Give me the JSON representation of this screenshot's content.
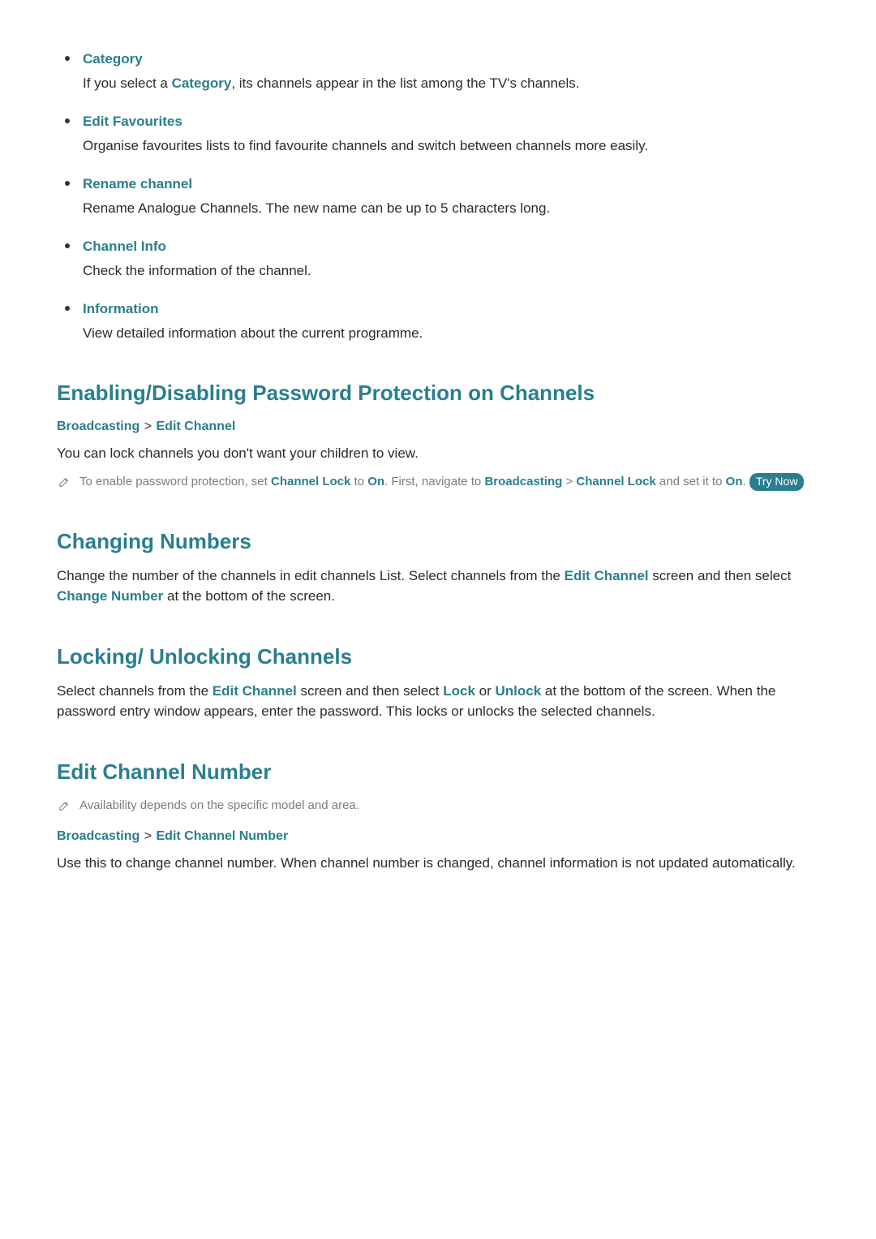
{
  "list": [
    {
      "title": "Category",
      "body_pre": "If you select a ",
      "body_link": "Category",
      "body_post": ", its channels appear in the list among the TV's channels."
    },
    {
      "title": "Edit Favourites",
      "body": "Organise favourites lists to find favourite channels and switch between channels more easily."
    },
    {
      "title": "Rename channel",
      "body": "Rename Analogue Channels. The new name can be up to 5 characters long."
    },
    {
      "title": "Channel Info",
      "body": "Check the information of the channel."
    },
    {
      "title": "Information",
      "body": "View detailed information about the current programme."
    }
  ],
  "sections": {
    "enabling": {
      "heading": "Enabling/Disabling Password Protection on Channels",
      "crumb1": "Broadcasting",
      "sep": ">",
      "crumb2": "Edit Channel",
      "body": "You can lock channels you don't want your children to view.",
      "note_t1": "To enable password protection, set ",
      "note_channel_lock": "Channel Lock",
      "note_t2": " to ",
      "note_on1": "On",
      "note_t3": ". First, navigate to ",
      "note_broadcasting": "Broadcasting",
      "note_sep": " > ",
      "note_channel_lock2": "Channel Lock",
      "note_t4": " and set it to ",
      "note_on2": "On",
      "note_t5": ". ",
      "try_now": "Try Now"
    },
    "changing": {
      "heading": "Changing Numbers",
      "body_pre": "Change the number of the channels in edit channels List. Select channels from the ",
      "edit_channel": "Edit Channel",
      "body_mid": " screen and then select ",
      "change_number": "Change Number",
      "body_post": " at the bottom of the screen."
    },
    "locking": {
      "heading": "Locking/ Unlocking Channels",
      "body_pre": "Select channels from the ",
      "edit_channel": "Edit Channel",
      "body_mid": " screen and then select ",
      "lock": "Lock",
      "or": " or ",
      "unlock": "Unlock",
      "body_post": " at the bottom of the screen. When the password entry window appears, enter the password. This locks or unlocks the selected channels."
    },
    "editnum": {
      "heading": "Edit Channel Number",
      "note": "Availability depends on the specific model and area.",
      "crumb1": "Broadcasting",
      "sep": ">",
      "crumb2": "Edit Channel Number",
      "body": "Use this to change channel number. When channel number is changed, channel information is not updated automatically."
    }
  }
}
